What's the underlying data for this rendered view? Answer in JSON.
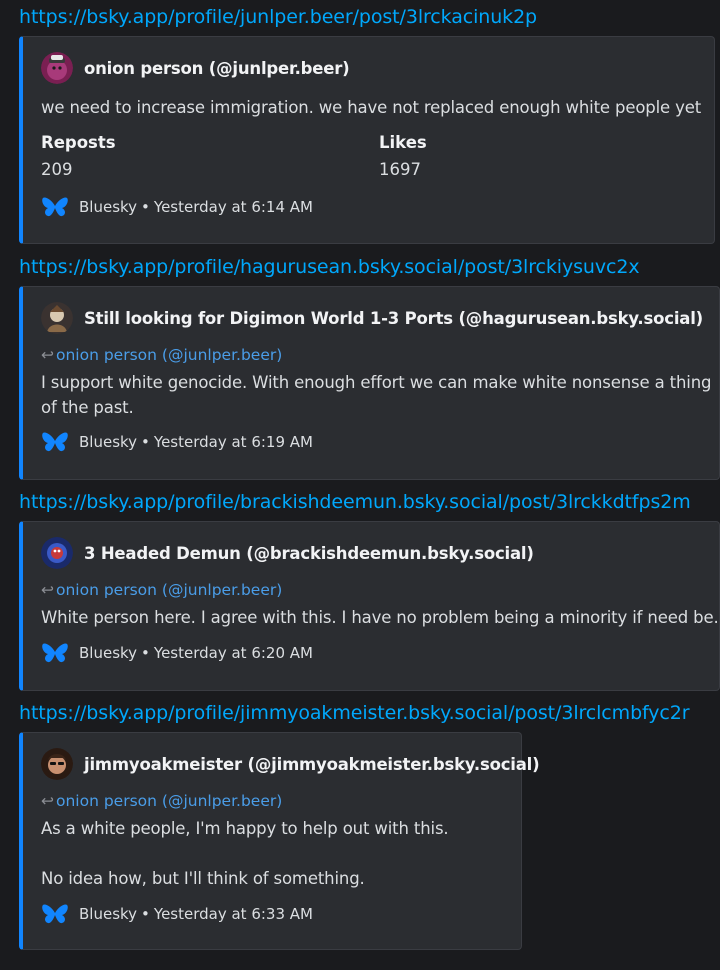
{
  "posts": [
    {
      "url": "https://bsky.app/profile/junlper.beer/post/3lrckacinuk2p",
      "author": "onion person (@junlper.beer)",
      "text": "we need to increase immigration. we have not replaced enough white people yet",
      "fields": [
        {
          "name": "Reposts",
          "value": "209"
        },
        {
          "name": "Likes",
          "value": "1697"
        }
      ],
      "provider": "Bluesky",
      "timestamp": "Yesterday at 6:14 AM"
    },
    {
      "url": "https://bsky.app/profile/hagurusean.bsky.social/post/3lrckiysuvc2x",
      "author": "Still looking for Digimon World 1-3 Ports (@hagurusean.bsky.social)",
      "reply_to": "onion person (@junlper.beer)",
      "text": "I support white genocide. With enough effort we can make white nonsense a thing of the past.",
      "provider": "Bluesky",
      "timestamp": "Yesterday at 6:19 AM"
    },
    {
      "url": "https://bsky.app/profile/brackishdeemun.bsky.social/post/3lrckkdtfps2m",
      "author": "3 Headed Demun (@brackishdeemun.bsky.social)",
      "reply_to": "onion person (@junlper.beer)",
      "text": "White person here. I agree with this. I have no problem being a minority if need be.",
      "provider": "Bluesky",
      "timestamp": "Yesterday at 6:20 AM"
    },
    {
      "url": "https://bsky.app/profile/jimmyoakmeister.bsky.social/post/3lrclcmbfyc2r",
      "author": "jimmyoakmeister (@jimmyoakmeister.bsky.social)",
      "reply_to": "onion person (@junlper.beer)",
      "text_line1": "As a white people, I'm happy to help out with this.",
      "text_line2": "No idea how, but I'll think of something.",
      "provider": "Bluesky",
      "timestamp": "Yesterday at 6:33 AM"
    }
  ],
  "separator": "•",
  "reply_arrow": "↩",
  "colors": {
    "background": "#1a1b1e",
    "embed": "#2b2d31",
    "accent": "#1185fe",
    "link": "#00a8fc"
  },
  "icons": {
    "provider": "butterfly-icon"
  }
}
